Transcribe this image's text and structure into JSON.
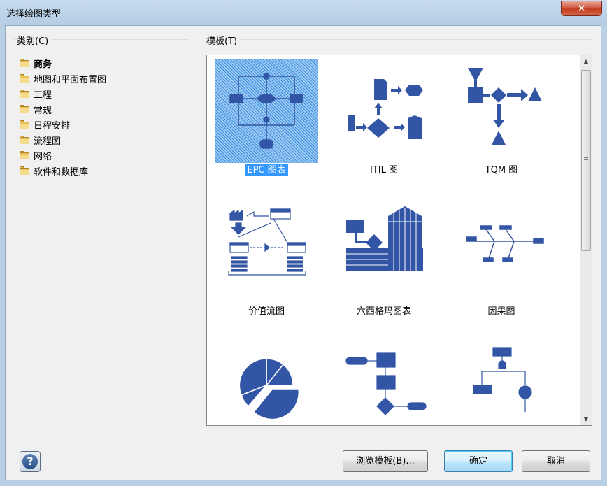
{
  "window": {
    "title": "选择绘图类型",
    "close_glyph": "✕"
  },
  "categories": {
    "label": "类别(C)",
    "items": [
      {
        "label": "商务",
        "selected": true
      },
      {
        "label": "地图和平面布置图",
        "selected": false
      },
      {
        "label": "工程",
        "selected": false
      },
      {
        "label": "常规",
        "selected": false
      },
      {
        "label": "日程安排",
        "selected": false
      },
      {
        "label": "流程图",
        "selected": false
      },
      {
        "label": "网络",
        "selected": false
      },
      {
        "label": "软件和数据库",
        "selected": false
      }
    ]
  },
  "templates": {
    "label": "模板(T)",
    "items": [
      {
        "label": "EPC 图表",
        "selected": true
      },
      {
        "label": "ITIL 图",
        "selected": false
      },
      {
        "label": "TQM 图",
        "selected": false
      },
      {
        "label": "价值流图",
        "selected": false
      },
      {
        "label": "六西格玛图表",
        "selected": false
      },
      {
        "label": "因果图",
        "selected": false
      },
      {
        "label": "",
        "selected": false
      },
      {
        "label": "",
        "selected": false
      },
      {
        "label": "",
        "selected": false
      }
    ]
  },
  "buttons": {
    "help_glyph": "?",
    "browse": "浏览模板(B)...",
    "ok": "确定",
    "cancel": "取消"
  },
  "colors": {
    "icon": "#3355a5",
    "selection": "#3399ff"
  }
}
